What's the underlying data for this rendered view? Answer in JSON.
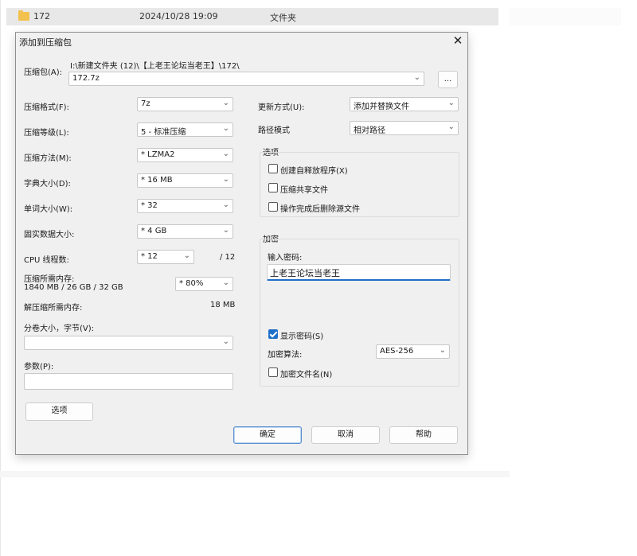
{
  "background": {
    "row_name": "172",
    "row_date": "2024/10/28 19:09",
    "row_type": "文件夹"
  },
  "dialog": {
    "title": "添加到压缩包",
    "close_glyph": "✕",
    "archive_label": "压缩包(A):",
    "archive_path": "I:\\新建文件夹 (12)\\【上老王论坛当老王】\\172\\",
    "archive_name": "172.7z",
    "browse_label": "...",
    "left": {
      "format_label": "压缩格式(F):",
      "format_value": "7z",
      "level_label": "压缩等级(L):",
      "level_value": "5 - 标准压缩",
      "method_label": "压缩方法(M):",
      "method_value": "* LZMA2",
      "dict_label": "字典大小(D):",
      "dict_value": "* 16 MB",
      "word_label": "单词大小(W):",
      "word_value": "* 32",
      "solid_label": "固实数据大小:",
      "solid_value": "* 4 GB",
      "cpu_label": "CPU 线程数:",
      "cpu_value": "* 12",
      "cpu_total": "/ 12",
      "mem_label": "压缩所需内存:",
      "mem_detail": "1840 MB / 26 GB / 32 GB",
      "mem_value": "* 80%",
      "decomp_label": "解压缩所需内存:",
      "decomp_value": "18 MB",
      "volume_label": "分卷大小，字节(V):",
      "params_label": "参数(P):",
      "options_button": "选项"
    },
    "right": {
      "update_label": "更新方式(U):",
      "update_value": "添加并替换文件",
      "pathmode_label": "路径模式",
      "pathmode_value": "相对路径",
      "options_group": "选项",
      "opt_sfx": "创建自释放程序(X)",
      "opt_shared": "压缩共享文件",
      "opt_delete": "操作完成后删除源文件",
      "encrypt_group": "加密",
      "password_label": "输入密码:",
      "password_value": "上老王论坛当老王",
      "show_password": "显示密码(S)",
      "method_label": "加密算法:",
      "method_value": "AES-256",
      "encrypt_names": "加密文件名(N)"
    },
    "buttons": {
      "ok": "确定",
      "cancel": "取消",
      "help": "帮助"
    }
  }
}
